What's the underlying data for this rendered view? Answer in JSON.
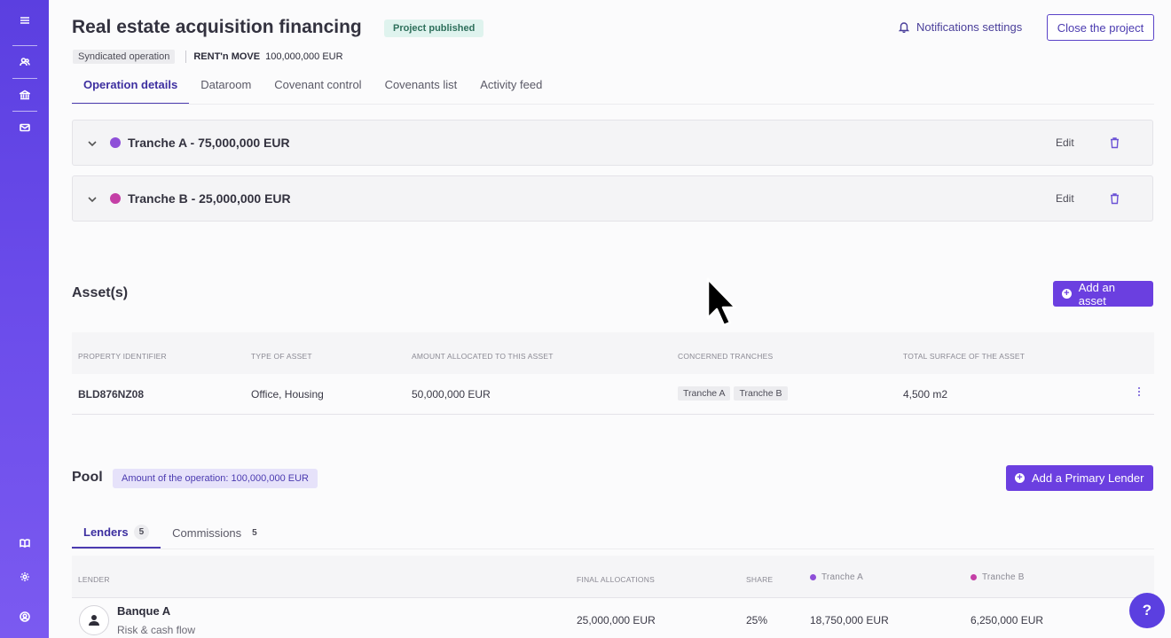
{
  "sidebar": {
    "top_icons": [
      "menu-icon",
      "users-icon",
      "bank-icon",
      "mail-icon"
    ],
    "bottom_icons": [
      "book-icon",
      "settings-icon",
      "profile-icon"
    ]
  },
  "header": {
    "title": "Real estate acquisition financing",
    "status_badge": "Project published",
    "notifications_label": "Notifications settings",
    "close_button": "Close the project",
    "operation_type": "Syndicated operation",
    "borrower": "RENT'n MOVE",
    "amount": "100,000,000 EUR"
  },
  "tabs": [
    {
      "label": "Operation details",
      "active": true
    },
    {
      "label": "Dataroom",
      "active": false
    },
    {
      "label": "Covenant control",
      "active": false
    },
    {
      "label": "Covenants list",
      "active": false
    },
    {
      "label": "Activity feed",
      "active": false
    }
  ],
  "tranches": [
    {
      "label": "Tranche A - 75,000,000 EUR",
      "color": "#8e4fd8",
      "edit_label": "Edit"
    },
    {
      "label": "Tranche B - 25,000,000 EUR",
      "color": "#c43fa6",
      "edit_label": "Edit"
    }
  ],
  "assets": {
    "title": "Asset(s)",
    "add_button": "Add an asset",
    "columns": [
      "PROPERTY IDENTIFIER",
      "TYPE OF ASSET",
      "AMOUNT ALLOCATED TO THIS ASSET",
      "CONCERNED TRANCHES",
      "TOTAL SURFACE OF THE ASSET"
    ],
    "rows": [
      {
        "identifier": "BLD876NZ08",
        "type": "Office, Housing",
        "amount": "50,000,000 EUR",
        "tranches": [
          "Tranche A",
          "Tranche B"
        ],
        "surface": "4,500 m2"
      }
    ]
  },
  "pool": {
    "title": "Pool",
    "amount_badge": "Amount of the operation: 100,000,000 EUR",
    "add_button": "Add a Primary Lender",
    "subtabs": [
      {
        "label": "Lenders",
        "count": "5",
        "active": true
      },
      {
        "label": "Commissions",
        "count": "5",
        "active": false
      }
    ],
    "columns": {
      "lender": "LENDER",
      "final_allocations": "FINAL ALLOCATIONS",
      "share": "SHARE",
      "tranche_a": "Tranche A",
      "tranche_b": "Tranche B"
    },
    "rows": [
      {
        "name": "Banque A",
        "role": "Risk & cash flow",
        "final_allocation": "25,000,000 EUR",
        "share": "25%",
        "tranche_a": "18,750,000 EUR",
        "tranche_b": "6,250,000 EUR"
      }
    ]
  },
  "help_label": "?"
}
